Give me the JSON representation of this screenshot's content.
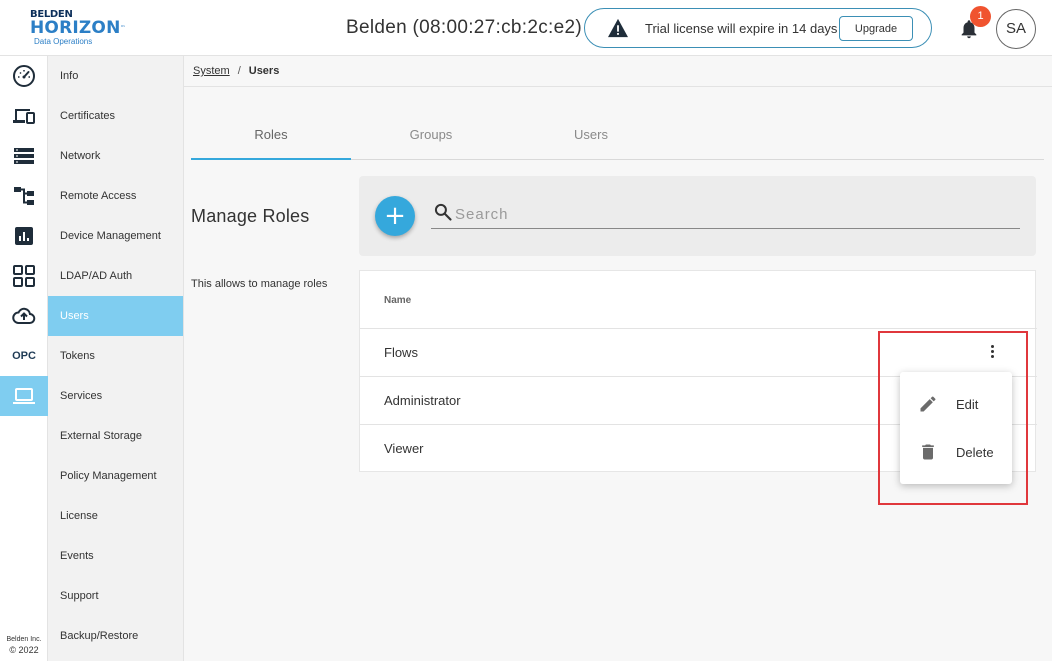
{
  "logo": {
    "line1": "BELDEN",
    "line2": "HORIZON",
    "tm": "™",
    "line3": "Data Operations"
  },
  "header": {
    "device_title": "Belden (08:00:27:cb:2c:e2)",
    "license_text": "Trial license will expire in 14 days",
    "upgrade_label": "Upgrade",
    "notification_count": "1",
    "avatar_initials": "SA"
  },
  "rail": {
    "items": [
      {
        "icon": "dashboard-gauge-icon"
      },
      {
        "icon": "devices-icon"
      },
      {
        "icon": "list-icon"
      },
      {
        "icon": "flow-diagram-icon"
      },
      {
        "icon": "analytics-chart-icon"
      },
      {
        "icon": "apps-grid-icon"
      },
      {
        "icon": "cloud-upload-icon"
      },
      {
        "icon": "opc-icon",
        "label": "OPC"
      },
      {
        "icon": "laptop-icon",
        "active": true
      }
    ],
    "copyright_line1": "Belden Inc.",
    "copyright_line2": "© 2022",
    "active_color": "#7fcdf0"
  },
  "subnav": {
    "items": [
      "Info",
      "Certificates",
      "Network",
      "Remote Access",
      "Device Management",
      "LDAP/AD Auth",
      "Users",
      "Tokens",
      "Services",
      "External Storage",
      "Policy Management",
      "License",
      "Events",
      "Support",
      "Backup/Restore"
    ],
    "active": "Users"
  },
  "breadcrumb": {
    "parent": "System",
    "separator": "/",
    "current": "Users"
  },
  "tabs": [
    "Roles",
    "Groups",
    "Users"
  ],
  "active_tab": "Roles",
  "section": {
    "title": "Manage Roles",
    "description": "This allows to manage roles"
  },
  "search": {
    "placeholder": "Search",
    "value": ""
  },
  "table": {
    "columns": [
      "Name"
    ],
    "rows": [
      "Flows",
      "Administrator",
      "Viewer"
    ]
  },
  "context_menu": {
    "items": [
      {
        "label": "Edit",
        "icon": "pencil-edit-icon"
      },
      {
        "label": "Delete",
        "icon": "trash-delete-icon"
      }
    ]
  },
  "colors": {
    "accent": "#35a8dc",
    "active_nav": "#7fcdf0",
    "badge": "#f0532f",
    "highlight": "#e0373c"
  }
}
